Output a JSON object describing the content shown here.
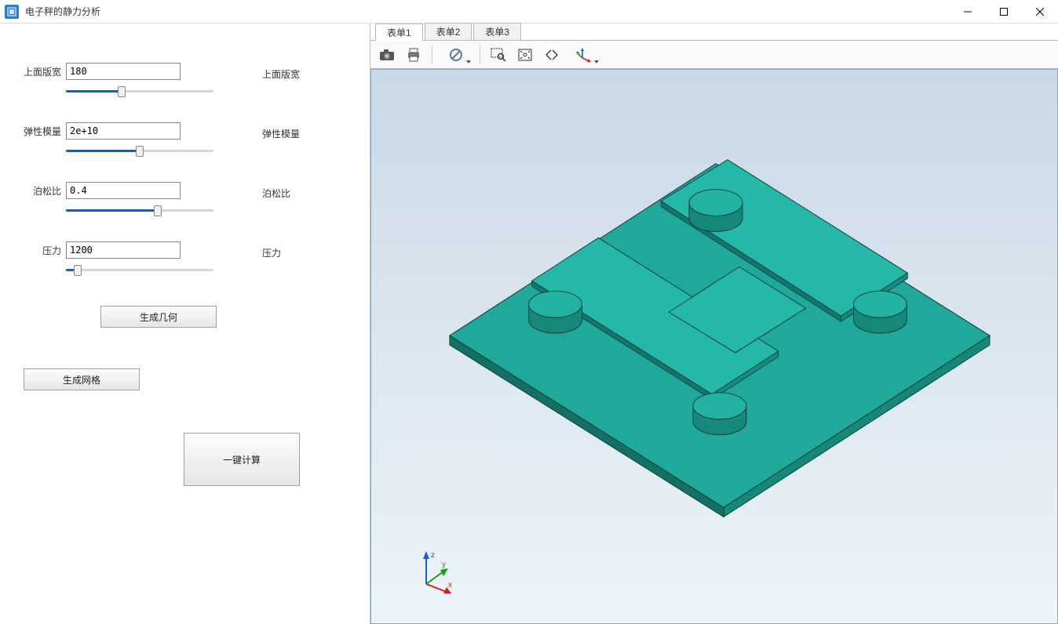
{
  "window": {
    "title": "电子秤的静力分析"
  },
  "params": [
    {
      "key": "width",
      "label": "上面版宽",
      "value": "180",
      "right_label": "上面版宽",
      "slider_pct": 38
    },
    {
      "key": "modulus",
      "label": "弹性模量",
      "value": "2e+10",
      "right_label": "弹性模量",
      "slider_pct": 50
    },
    {
      "key": "poisson",
      "label": "泊松比",
      "value": "0.4",
      "right_label": "泊松比",
      "slider_pct": 62
    },
    {
      "key": "pressure",
      "label": "压力",
      "value": "1200",
      "right_label": "压力",
      "slider_pct": 8
    }
  ],
  "buttons": {
    "gen_geom": "生成几何",
    "gen_mesh": "生成网格",
    "calc": "一键计算"
  },
  "tabs": [
    {
      "label": "表单1",
      "active": true
    },
    {
      "label": "表单2",
      "active": false
    },
    {
      "label": "表单3",
      "active": false
    }
  ],
  "toolbar": {
    "camera": "camera-icon",
    "print": "print-icon",
    "nosymbol": "no-symbol-icon",
    "zoomwin": "zoom-window-icon",
    "fit": "fit-view-icon",
    "extents": "zoom-extents-icon",
    "axes": "axes-icon"
  },
  "triad": {
    "x": "x",
    "y": "y",
    "z": "z"
  },
  "colors": {
    "model_face": "#1fa99a",
    "model_edge": "#0d3f3a",
    "accent": "#0066cc"
  }
}
